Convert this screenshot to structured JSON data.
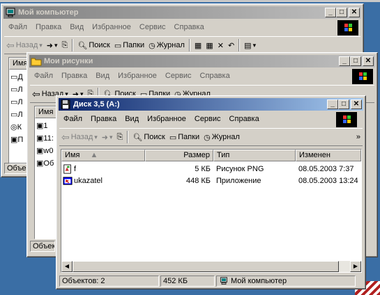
{
  "windows": {
    "my_computer": {
      "title": "Мой компьютер",
      "menu": [
        "Файл",
        "Правка",
        "Вид",
        "Избранное",
        "Сервис",
        "Справка"
      ],
      "toolbar": {
        "back": "Назад",
        "search": "Поиск",
        "folders": "Папки",
        "history": "Журнал"
      },
      "column_name": "Имя",
      "items": [
        "Д",
        "Л",
        "Л",
        "Л",
        "К",
        "П"
      ],
      "status": "Объек"
    },
    "my_pictures": {
      "title": "Мои рисунки",
      "menu": [
        "Файл",
        "Правка",
        "Вид",
        "Избранное",
        "Сервис",
        "Справка"
      ],
      "toolbar": {
        "back": "Назад",
        "search": "Поиск",
        "folders": "Папки",
        "history": "Журнал"
      },
      "column_name": "Имя",
      "items": [
        "1",
        "11:",
        "w0",
        "Об"
      ],
      "status": "Объект"
    },
    "floppy": {
      "title": "Диск 3,5 (A:)",
      "menu": [
        "Файл",
        "Правка",
        "Вид",
        "Избранное",
        "Сервис",
        "Справка"
      ],
      "toolbar": {
        "back": "Назад",
        "search": "Поиск",
        "folders": "Папки",
        "history": "Журнал",
        "more": "»"
      },
      "columns": {
        "name": "Имя",
        "size": "Размер",
        "type": "Тип",
        "modified": "Изменен"
      },
      "files": [
        {
          "name": "f",
          "size": "5 КБ",
          "type": "Рисунок PNG",
          "modified": "08.05.2003 7:37",
          "icon": "png-file-icon"
        },
        {
          "name": "ukazatel",
          "size": "448 КБ",
          "type": "Приложение",
          "modified": "08.05.2003 13:24",
          "icon": "application-icon"
        }
      ],
      "status": {
        "count": "Объектов: 2",
        "size": "452 КБ",
        "location": "Мой компьютер"
      }
    }
  },
  "colors": {
    "desktop": "#3a6ea5",
    "active_title": "#0a246a",
    "inactive_title": "#808080",
    "face": "#d4d0c8"
  }
}
